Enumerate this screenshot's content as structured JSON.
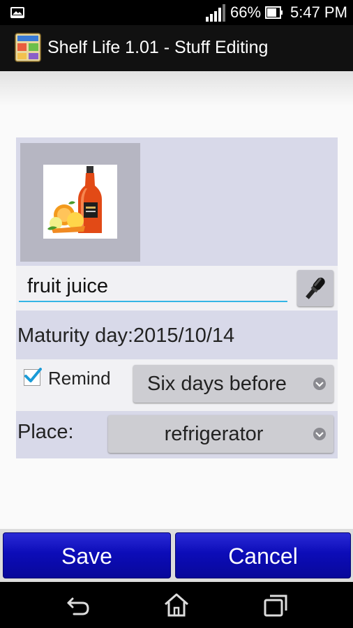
{
  "status_bar": {
    "battery_percent": "66%",
    "time": "5:47 PM",
    "icons": [
      "notification-icon",
      "signal-icon",
      "battery-icon"
    ]
  },
  "app_bar": {
    "title": "Shelf Life 1.01 - Stuff Editing",
    "icon": "shelf-life-app-icon"
  },
  "form": {
    "photo": {
      "icon": "fruit-juice-photo"
    },
    "name_value": "fruit juice",
    "voice_icon": "microphone-icon",
    "maturity_text": "Maturity day:2015/10/14",
    "remind": {
      "checked": true,
      "label": "Remind",
      "selected": "Six days before"
    },
    "place": {
      "label": "Place:",
      "selected": "refrigerator"
    }
  },
  "actions": {
    "save_label": "Save",
    "cancel_label": "Cancel"
  },
  "nav_bar": {
    "icons": [
      "back-icon",
      "home-icon",
      "recents-icon"
    ]
  },
  "colors": {
    "accent_underline": "#33b5e5",
    "button_blue": "#0c0cb8",
    "panel_bg": "#d8d9e9"
  }
}
